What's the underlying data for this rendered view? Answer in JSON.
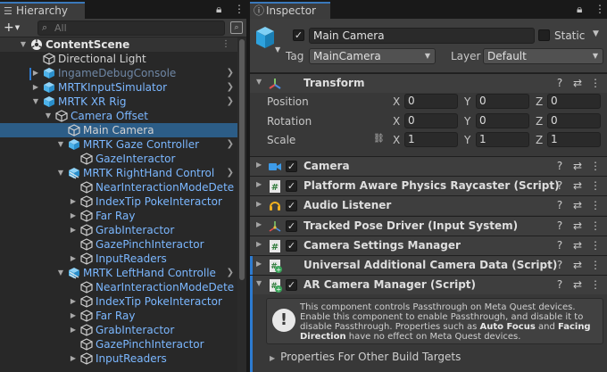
{
  "hierarchy": {
    "tab_label": "Hierarchy",
    "search_placeholder": "All",
    "rows": [
      {
        "label": "ContentScene",
        "indent": 0,
        "fold": "down",
        "icon": "unity-scene-icon",
        "style": "bold"
      },
      {
        "label": "Directional Light",
        "indent": 1,
        "fold": "",
        "icon": "gameobject-icon",
        "style": "plain"
      },
      {
        "label": "IngameDebugConsole",
        "indent": 1,
        "fold": "right",
        "icon": "prefab-icon",
        "style": "disabled",
        "go": true
      },
      {
        "label": "MRTKInputSimulator",
        "indent": 1,
        "fold": "right",
        "icon": "prefab-icon",
        "style": "pref",
        "go": true
      },
      {
        "label": "MRTK XR Rig",
        "indent": 1,
        "fold": "down",
        "icon": "prefab-icon",
        "style": "pref",
        "go": true
      },
      {
        "label": "Camera Offset",
        "indent": 2,
        "fold": "down",
        "icon": "gameobject-icon",
        "style": "pref"
      },
      {
        "label": "Main Camera",
        "indent": 3,
        "fold": "",
        "icon": "gameobject-icon",
        "style": "plain",
        "selected": true
      },
      {
        "label": "MRTK Gaze Controller",
        "indent": 3,
        "fold": "down",
        "icon": "prefab-icon",
        "style": "pref",
        "go": true
      },
      {
        "label": "GazeInteractor",
        "indent": 4,
        "fold": "",
        "icon": "gameobject-icon",
        "style": "pref"
      },
      {
        "label": "MRTK RightHand Control",
        "indent": 3,
        "fold": "down",
        "icon": "prefab-variant-icon",
        "style": "pref",
        "go": true
      },
      {
        "label": "NearInteractionModeDete",
        "indent": 4,
        "fold": "",
        "icon": "gameobject-icon",
        "style": "pref"
      },
      {
        "label": "IndexTip PokeInteractor",
        "indent": 4,
        "fold": "right",
        "icon": "gameobject-icon",
        "style": "pref"
      },
      {
        "label": "Far Ray",
        "indent": 4,
        "fold": "right",
        "icon": "gameobject-icon",
        "style": "pref"
      },
      {
        "label": "GrabInteractor",
        "indent": 4,
        "fold": "right",
        "icon": "gameobject-icon",
        "style": "pref"
      },
      {
        "label": "GazePinchInteractor",
        "indent": 4,
        "fold": "",
        "icon": "gameobject-icon",
        "style": "pref"
      },
      {
        "label": "InputReaders",
        "indent": 4,
        "fold": "right",
        "icon": "gameobject-icon",
        "style": "pref"
      },
      {
        "label": "MRTK LeftHand Controlle",
        "indent": 3,
        "fold": "down",
        "icon": "prefab-variant-icon",
        "style": "pref",
        "go": true
      },
      {
        "label": "NearInteractionModeDete",
        "indent": 4,
        "fold": "",
        "icon": "gameobject-icon",
        "style": "pref"
      },
      {
        "label": "IndexTip PokeInteractor",
        "indent": 4,
        "fold": "right",
        "icon": "gameobject-icon",
        "style": "pref"
      },
      {
        "label": "Far Ray",
        "indent": 4,
        "fold": "right",
        "icon": "gameobject-icon",
        "style": "pref"
      },
      {
        "label": "GrabInteractor",
        "indent": 4,
        "fold": "right",
        "icon": "gameobject-icon",
        "style": "pref"
      },
      {
        "label": "GazePinchInteractor",
        "indent": 4,
        "fold": "",
        "icon": "gameobject-icon",
        "style": "pref"
      },
      {
        "label": "InputReaders",
        "indent": 4,
        "fold": "right",
        "icon": "gameobject-icon",
        "style": "pref"
      }
    ]
  },
  "inspector": {
    "tab_label": "Inspector",
    "object_name": "Main Camera",
    "static_label": "Static",
    "tag_label": "Tag",
    "tag_value": "MainCamera",
    "layer_label": "Layer",
    "layer_value": "Default",
    "transform": {
      "title": "Transform",
      "position_label": "Position",
      "rotation_label": "Rotation",
      "scale_label": "Scale",
      "x_label": "X",
      "y_label": "Y",
      "z_label": "Z",
      "position": [
        "0",
        "0",
        "0"
      ],
      "rotation": [
        "0",
        "0",
        "0"
      ],
      "scale": [
        "1",
        "1",
        "1"
      ]
    },
    "components": [
      {
        "title": "Camera",
        "icon": "camera-icon",
        "checked": true
      },
      {
        "title": "Platform Aware Physics Raycaster (Script)",
        "icon": "script-icon",
        "checked": true
      },
      {
        "title": "Audio Listener",
        "icon": "audio-listener-icon",
        "checked": true
      },
      {
        "title": "Tracked Pose Driver (Input System)",
        "icon": "tracked-pose-icon",
        "checked": true
      },
      {
        "title": "Camera Settings Manager",
        "icon": "script-icon",
        "checked": true
      },
      {
        "title": "Universal Additional Camera Data (Script)",
        "icon": "script-added-icon",
        "checked": false
      },
      {
        "title": "AR Camera Manager (Script)",
        "icon": "script-added-icon",
        "checked": true
      }
    ],
    "help": {
      "text_1": "This component controls Passthrough on Meta Quest devices. Enable this component to enable Passthrough, and disable it to disable Passthrough. Properties such as ",
      "bold_1": "Auto Focus",
      "text_2": " and ",
      "bold_2": "Facing Direction",
      "text_3": " have no effect on Meta Quest devices."
    },
    "foldout_label": "Properties For Other Build Targets"
  },
  "colors": {
    "selection": "#2c5d87",
    "prefab_text": "#7bb7ff",
    "accent_blue": "#2d7bd1"
  }
}
